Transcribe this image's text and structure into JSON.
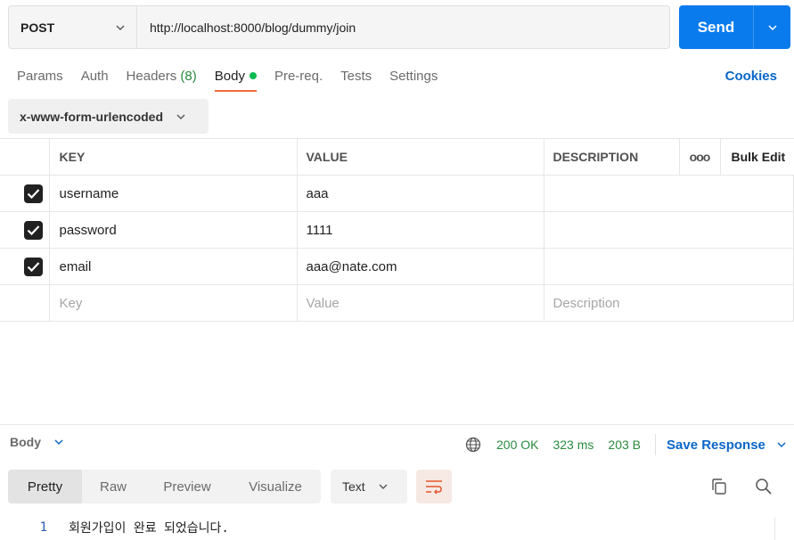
{
  "request": {
    "method": "POST",
    "url": "http://localhost:8000/blog/dummy/join",
    "send_label": "Send"
  },
  "tabs": [
    {
      "label": "Params"
    },
    {
      "label": "Auth"
    },
    {
      "label": "Headers",
      "count": "(8)"
    },
    {
      "label": "Body",
      "active": true
    },
    {
      "label": "Pre-req."
    },
    {
      "label": "Tests"
    },
    {
      "label": "Settings"
    }
  ],
  "cookies_label": "Cookies",
  "body_type": "x-www-form-urlencoded",
  "table": {
    "headers": [
      "KEY",
      "VALUE",
      "DESCRIPTION",
      "Bulk Edit"
    ],
    "more_label": "ooo",
    "rows": [
      {
        "key": "username",
        "value": "aaa",
        "checked": true
      },
      {
        "key": "password",
        "value": "1111",
        "checked": true
      },
      {
        "key": "email",
        "value": "aaa@nate.com",
        "checked": true
      }
    ],
    "placeholders": {
      "key": "Key",
      "value": "Value",
      "description": "Description"
    }
  },
  "response": {
    "body_label": "Body",
    "status": "200 OK",
    "time": "323 ms",
    "size": "203 B",
    "save_label": "Save Response",
    "view_tabs": [
      "Pretty",
      "Raw",
      "Preview",
      "Visualize"
    ],
    "format": "Text",
    "lines": [
      {
        "num": "1",
        "text": "회원가입이 완료 되었습니다."
      }
    ]
  },
  "colors": {
    "send": "#097bed",
    "accent_tab": "#f26b3a",
    "status_green": "#2a8a3e",
    "link_blue": "#0a66c7"
  },
  "icons": [
    "chevron-down-icon",
    "globe-icon",
    "wrap-lines-icon",
    "copy-icon",
    "search-icon",
    "checkbox-checked-icon"
  ]
}
